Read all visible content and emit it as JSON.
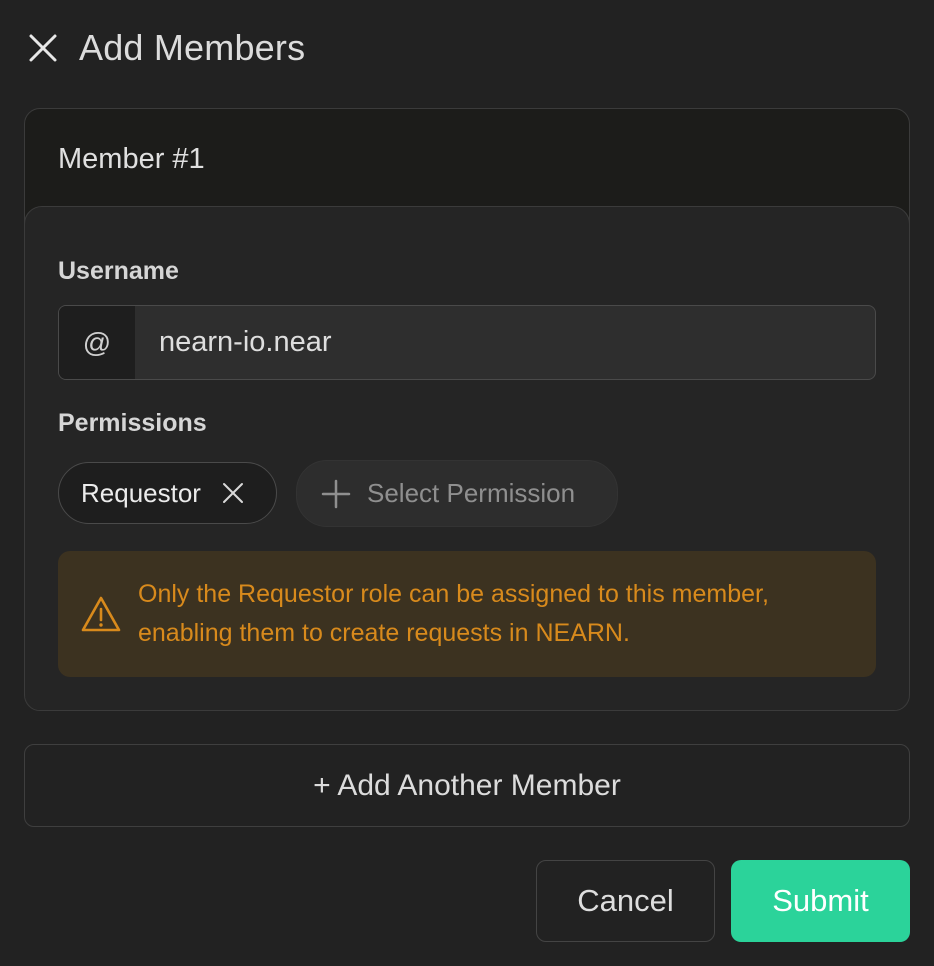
{
  "header": {
    "close_icon": "close-icon",
    "title": "Add Members"
  },
  "member": {
    "title": "Member #1",
    "username_label": "Username",
    "username_prefix": "@",
    "username_value": "nearn-io.near",
    "permissions_label": "Permissions",
    "chips": [
      {
        "label": "Requestor",
        "icon": "close-icon"
      }
    ],
    "select_permission_label": "Select Permission",
    "warning": {
      "icon": "warning-icon",
      "text_line1": "Only the Requestor role can be assigned to this member,",
      "text_line2": "enabling them to create requests in NEARN.",
      "color": "#d88a1c"
    }
  },
  "add_member_label": "+ Add Another Member",
  "footer": {
    "cancel_label": "Cancel",
    "submit_label": "Submit",
    "submit_color": "#2bd39a"
  }
}
